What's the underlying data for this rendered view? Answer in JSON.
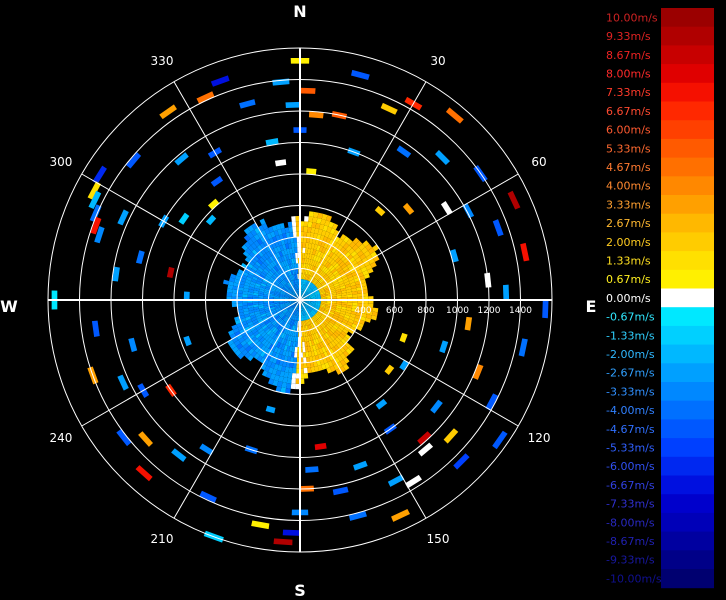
{
  "chart_data": {
    "type": "polar-radar",
    "title": "",
    "compass": {
      "north": "N",
      "east": "E",
      "south": "S",
      "west": "W"
    },
    "angle_labels": [
      {
        "deg": 30,
        "text": "30"
      },
      {
        "deg": 60,
        "text": "60"
      },
      {
        "deg": 120,
        "text": "120"
      },
      {
        "deg": 150,
        "text": "150"
      },
      {
        "deg": 210,
        "text": "210"
      },
      {
        "deg": 240,
        "text": "240"
      },
      {
        "deg": 300,
        "text": "300"
      },
      {
        "deg": 330,
        "text": "330"
      }
    ],
    "range_rings": [
      200,
      400,
      600,
      800,
      1000,
      1200,
      1400,
      1600
    ],
    "range_labels": [
      {
        "value": 400,
        "text": "400"
      },
      {
        "value": 600,
        "text": "600"
      },
      {
        "value": 800,
        "text": "800"
      },
      {
        "value": 1000,
        "text": "1000"
      },
      {
        "value": 1200,
        "text": "1200"
      },
      {
        "value": 1400,
        "text": "1400"
      }
    ],
    "range_max": 1600,
    "legend": {
      "unit": "m/s",
      "min": -10.0,
      "max": 10.0,
      "entries": [
        {
          "value": 10.0,
          "label": "10.00m/s",
          "color": "#9b0000",
          "text_color": "#cc2222"
        },
        {
          "value": 9.33,
          "label": "9.33m/s",
          "color": "#b00000",
          "text_color": "#dd2222"
        },
        {
          "value": 8.67,
          "label": "8.67m/s",
          "color": "#c80000",
          "text_color": "#ee2222"
        },
        {
          "value": 8.0,
          "label": "8.00m/s",
          "color": "#e00000",
          "text_color": "#ff2a2a"
        },
        {
          "value": 7.33,
          "label": "7.33m/s",
          "color": "#f51000",
          "text_color": "#ff3a2a"
        },
        {
          "value": 6.67,
          "label": "6.67m/s",
          "color": "#ff2800",
          "text_color": "#ff4a30"
        },
        {
          "value": 6.0,
          "label": "6.00m/s",
          "color": "#ff4000",
          "text_color": "#ff5a30"
        },
        {
          "value": 5.33,
          "label": "5.33m/s",
          "color": "#ff5a00",
          "text_color": "#ff6a30"
        },
        {
          "value": 4.67,
          "label": "4.67m/s",
          "color": "#ff7000",
          "text_color": "#ff7a30"
        },
        {
          "value": 4.0,
          "label": "4.00m/s",
          "color": "#ff8800",
          "text_color": "#ff8a30"
        },
        {
          "value": 3.33,
          "label": "3.33m/s",
          "color": "#ffa000",
          "text_color": "#ffa030"
        },
        {
          "value": 2.67,
          "label": "2.67m/s",
          "color": "#ffb800",
          "text_color": "#ffb830"
        },
        {
          "value": 2.0,
          "label": "2.00m/s",
          "color": "#ffcc00",
          "text_color": "#ffcc20"
        },
        {
          "value": 1.33,
          "label": "1.33m/s",
          "color": "#ffe000",
          "text_color": "#ffe020"
        },
        {
          "value": 0.67,
          "label": "0.67m/s",
          "color": "#fff000",
          "text_color": "#fff020"
        },
        {
          "value": 0.0,
          "label": "0.00m/s",
          "color": "#ffffff",
          "text_color": "#ffffff"
        },
        {
          "value": -0.67,
          "label": "-0.67m/s",
          "color": "#00e8ff",
          "text_color": "#30e8ff"
        },
        {
          "value": -1.33,
          "label": "-1.33m/s",
          "color": "#00d0ff",
          "text_color": "#30d0ff"
        },
        {
          "value": -2.0,
          "label": "-2.00m/s",
          "color": "#00b8ff",
          "text_color": "#30b8ff"
        },
        {
          "value": -2.67,
          "label": "-2.67m/s",
          "color": "#00a0ff",
          "text_color": "#30a0ff"
        },
        {
          "value": -3.33,
          "label": "-3.33m/s",
          "color": "#0088ff",
          "text_color": "#3090ff"
        },
        {
          "value": -4.0,
          "label": "-4.00m/s",
          "color": "#0070ff",
          "text_color": "#3080ff"
        },
        {
          "value": -4.67,
          "label": "-4.67m/s",
          "color": "#0058ff",
          "text_color": "#3070ff"
        },
        {
          "value": -5.33,
          "label": "-5.33m/s",
          "color": "#0040ff",
          "text_color": "#3060ff"
        },
        {
          "value": -6.0,
          "label": "-6.00m/s",
          "color": "#0028f0",
          "text_color": "#3050f0"
        },
        {
          "value": -6.67,
          "label": "-6.67m/s",
          "color": "#0010e0",
          "text_color": "#3040e0"
        },
        {
          "value": -7.33,
          "label": "-7.33m/s",
          "color": "#0000cc",
          "text_color": "#3030d0"
        },
        {
          "value": -8.0,
          "label": "-8.00m/s",
          "color": "#0000b8",
          "text_color": "#2828c0"
        },
        {
          "value": -8.67,
          "label": "-8.67m/s",
          "color": "#0000a0",
          "text_color": "#2020b0"
        },
        {
          "value": -9.33,
          "label": "-9.33m/s",
          "color": "#000088",
          "text_color": "#1818a0"
        },
        {
          "value": -10.0,
          "label": "-10.00m/s",
          "color": "#000070",
          "text_color": "#101090"
        }
      ]
    },
    "dense_region": {
      "range_max_approx": 600,
      "approach_half_mean": -3.0,
      "recede_half_mean": 1.5
    },
    "scattered_cells": [
      {
        "az": 0,
        "r": 1520,
        "v": 0.9
      },
      {
        "az": 355,
        "r": 1390,
        "v": -3.0
      },
      {
        "az": 2,
        "r": 1330,
        "v": 5.5
      },
      {
        "az": 358,
        "r": 1240,
        "v": -2.5
      },
      {
        "az": 5,
        "r": 1180,
        "v": 4.2
      },
      {
        "az": 0,
        "r": 1080,
        "v": -5.0
      },
      {
        "az": 350,
        "r": 1020,
        "v": -2.0
      },
      {
        "az": 352,
        "r": 880,
        "v": 0.0
      },
      {
        "az": 5,
        "r": 820,
        "v": 0.9
      },
      {
        "az": 345,
        "r": 1290,
        "v": -4.0
      },
      {
        "az": 340,
        "r": 1480,
        "v": -6.5
      },
      {
        "az": 335,
        "r": 1420,
        "v": 4.5
      },
      {
        "az": 325,
        "r": 1460,
        "v": 3.5
      },
      {
        "az": 330,
        "r": 1080,
        "v": -4.5
      },
      {
        "az": 320,
        "r": 1170,
        "v": -3.0
      },
      {
        "az": 310,
        "r": 1380,
        "v": -5.0
      },
      {
        "az": 302,
        "r": 1500,
        "v": -6.0
      },
      {
        "az": 298,
        "r": 1480,
        "v": 1.5
      },
      {
        "az": 296,
        "r": 1450,
        "v": -2.0
      },
      {
        "az": 293,
        "r": 1410,
        "v": -4.0
      },
      {
        "az": 290,
        "r": 1380,
        "v": 7.5
      },
      {
        "az": 288,
        "r": 1340,
        "v": -3.5
      },
      {
        "az": 295,
        "r": 1240,
        "v": -2.5
      },
      {
        "az": 300,
        "r": 1000,
        "v": -3.0
      },
      {
        "az": 305,
        "r": 900,
        "v": -1.5
      },
      {
        "az": 285,
        "r": 1050,
        "v": -4.0
      },
      {
        "az": 282,
        "r": 840,
        "v": 9.0
      },
      {
        "az": 278,
        "r": 1180,
        "v": -3.0
      },
      {
        "az": 270,
        "r": 1560,
        "v": -1.0
      },
      {
        "az": 272,
        "r": 720,
        "v": -3.0
      },
      {
        "az": 262,
        "r": 1310,
        "v": -4.5
      },
      {
        "az": 255,
        "r": 1100,
        "v": -3.5
      },
      {
        "az": 250,
        "r": 1400,
        "v": 3.5
      },
      {
        "az": 245,
        "r": 1240,
        "v": -2.5
      },
      {
        "az": 240,
        "r": 1150,
        "v": -5.0
      },
      {
        "az": 235,
        "r": 1000,
        "v": 6.5
      },
      {
        "az": 232,
        "r": 1420,
        "v": -4.5
      },
      {
        "az": 228,
        "r": 1320,
        "v": 3.0
      },
      {
        "az": 222,
        "r": 1480,
        "v": 7.0
      },
      {
        "az": 218,
        "r": 1250,
        "v": -2.5
      },
      {
        "az": 212,
        "r": 1120,
        "v": -3.5
      },
      {
        "az": 205,
        "r": 1380,
        "v": -5.0
      },
      {
        "az": 198,
        "r": 1000,
        "v": -4.0
      },
      {
        "az": 190,
        "r": 1450,
        "v": 1.0
      },
      {
        "az": 184,
        "r": 1540,
        "v": 9.0
      },
      {
        "az": 182,
        "r": 1480,
        "v": -7.0
      },
      {
        "az": 180,
        "r": 1350,
        "v": -3.5
      },
      {
        "az": 178,
        "r": 1200,
        "v": 4.5
      },
      {
        "az": 176,
        "r": 1080,
        "v": -4.0
      },
      {
        "az": 172,
        "r": 940,
        "v": 8.0
      },
      {
        "az": 168,
        "r": 1240,
        "v": -5.0
      },
      {
        "az": 165,
        "r": 1420,
        "v": -4.0
      },
      {
        "az": 160,
        "r": 1120,
        "v": -3.0
      },
      {
        "az": 155,
        "r": 1510,
        "v": 3.5
      },
      {
        "az": 152,
        "r": 1300,
        "v": -2.5
      },
      {
        "az": 148,
        "r": 1360,
        "v": 0.0
      },
      {
        "az": 145,
        "r": 1000,
        "v": -4.5
      },
      {
        "az": 142,
        "r": 840,
        "v": -3.0
      },
      {
        "az": 138,
        "r": 1180,
        "v": 8.5
      },
      {
        "az": 135,
        "r": 1450,
        "v": -5.5
      },
      {
        "az": 132,
        "r": 1290,
        "v": 2.0
      },
      {
        "az": 128,
        "r": 1100,
        "v": -3.5
      },
      {
        "az": 125,
        "r": 1550,
        "v": -4.5
      },
      {
        "az": 122,
        "r": 780,
        "v": -2.5
      },
      {
        "az": 118,
        "r": 1380,
        "v": -5.0
      },
      {
        "az": 112,
        "r": 1220,
        "v": 4.0
      },
      {
        "az": 108,
        "r": 960,
        "v": -3.0
      },
      {
        "az": 102,
        "r": 1450,
        "v": -4.0
      },
      {
        "az": 98,
        "r": 1080,
        "v": 3.5
      },
      {
        "az": 92,
        "r": 1560,
        "v": -5.0
      },
      {
        "az": 88,
        "r": 1310,
        "v": -2.5
      },
      {
        "az": 84,
        "r": 1200,
        "v": 0.0
      },
      {
        "az": 78,
        "r": 1460,
        "v": 7.0
      },
      {
        "az": 74,
        "r": 1020,
        "v": -3.0
      },
      {
        "az": 70,
        "r": 1340,
        "v": -4.5
      },
      {
        "az": 65,
        "r": 1500,
        "v": 9.0
      },
      {
        "az": 62,
        "r": 1210,
        "v": -3.5
      },
      {
        "az": 58,
        "r": 1100,
        "v": 0.0
      },
      {
        "az": 55,
        "r": 1400,
        "v": -5.0
      },
      {
        "az": 50,
        "r": 900,
        "v": 3.5
      },
      {
        "az": 45,
        "r": 1280,
        "v": -2.5
      },
      {
        "az": 40,
        "r": 1530,
        "v": 4.5
      },
      {
        "az": 35,
        "r": 1150,
        "v": -4.0
      },
      {
        "az": 30,
        "r": 1440,
        "v": 6.5
      },
      {
        "az": 25,
        "r": 1340,
        "v": 2.0
      },
      {
        "az": 20,
        "r": 1000,
        "v": -3.0
      },
      {
        "az": 15,
        "r": 1480,
        "v": -5.0
      },
      {
        "az": 12,
        "r": 1200,
        "v": 5.0
      },
      {
        "az": 318,
        "r": 820,
        "v": 1.0
      },
      {
        "az": 312,
        "r": 760,
        "v": -2.0
      },
      {
        "az": 42,
        "r": 760,
        "v": 2.0
      },
      {
        "az": 110,
        "r": 700,
        "v": 1.5
      },
      {
        "az": 195,
        "r": 720,
        "v": -2.5
      },
      {
        "az": 250,
        "r": 760,
        "v": -3.0
      },
      {
        "az": 140,
        "r": 1240,
        "v": 0.0
      },
      {
        "az": 128,
        "r": 720,
        "v": 1.8
      },
      {
        "az": 200,
        "r": 1600,
        "v": -1.5
      },
      {
        "az": 325,
        "r": 920,
        "v": -4.5
      }
    ]
  }
}
